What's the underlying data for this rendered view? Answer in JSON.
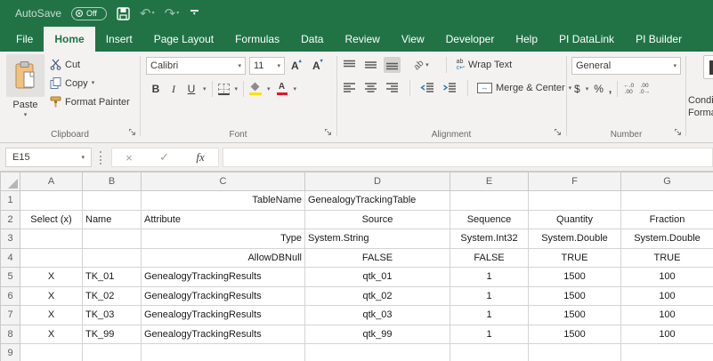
{
  "colors": {
    "title_green": "#217346",
    "cell_blue": "#2a2ad0",
    "selection_green": "#217346"
  },
  "titlebar": {
    "autosave_label": "AutoSave",
    "autosave_state": "Off"
  },
  "tabs": [
    {
      "label": "File",
      "active": false
    },
    {
      "label": "Home",
      "active": true
    },
    {
      "label": "Insert",
      "active": false
    },
    {
      "label": "Page Layout",
      "active": false
    },
    {
      "label": "Formulas",
      "active": false
    },
    {
      "label": "Data",
      "active": false
    },
    {
      "label": "Review",
      "active": false
    },
    {
      "label": "View",
      "active": false
    },
    {
      "label": "Developer",
      "active": false
    },
    {
      "label": "Help",
      "active": false
    },
    {
      "label": "PI DataLink",
      "active": false
    },
    {
      "label": "PI Builder",
      "active": false
    }
  ],
  "ribbon": {
    "clipboard": {
      "paste": "Paste",
      "cut": "Cut",
      "copy": "Copy",
      "format_painter": "Format Painter",
      "label": "Clipboard"
    },
    "font": {
      "name": "Calibri",
      "size": "11",
      "bold": "B",
      "italic": "I",
      "underline": "U",
      "grow_glyph": "A",
      "shrink_glyph": "A",
      "color_glyph": "A",
      "label": "Font"
    },
    "alignment": {
      "orientation_glyph": "ab",
      "wrap_glyph1": "ab",
      "wrap_glyph2": "c↩",
      "wrap_text": "Wrap Text",
      "merge_center": "Merge & Center",
      "merge_glyph": "↔",
      "label": "Alignment"
    },
    "number": {
      "format": "General",
      "currency": "$",
      "percent": "%",
      "comma": ",",
      "inc_top": "←.0",
      "inc_bottom": ".00",
      "dec_top": ".00",
      "dec_bottom": ".0→",
      "label": "Number"
    },
    "conditional": {
      "line1": "Conditional",
      "line2": "Formatting"
    }
  },
  "formula_bar": {
    "name_box": "E15",
    "cancel": "×",
    "enter": "✓",
    "fx": "fx",
    "formula": ""
  },
  "icons": {
    "dropdown": "▾",
    "up_caret": "▴",
    "undo": "↶",
    "redo": "↷"
  },
  "sheet": {
    "cols": [
      "A",
      "B",
      "C",
      "D",
      "E",
      "F",
      "G"
    ],
    "selected_col": "E",
    "rows": [
      "1",
      "2",
      "3",
      "4",
      "5",
      "6",
      "7",
      "8",
      "9"
    ],
    "r1": {
      "C": "TableName",
      "D": "GenealogyTrackingTable"
    },
    "r2": {
      "A": "Select (x)",
      "B": "Name",
      "C": "Attribute",
      "D": "Source",
      "E": "Sequence",
      "F": "Quantity",
      "G": "Fraction"
    },
    "r3": {
      "C": "Type",
      "D": "System.String",
      "E": "System.Int32",
      "F": "System.Double",
      "G": "System.Double"
    },
    "r4": {
      "C": "AllowDBNull",
      "D": "FALSE",
      "E": "FALSE",
      "F": "TRUE",
      "G": "TRUE"
    },
    "r5": {
      "A": "X",
      "B": "TK_01",
      "C": "GenealogyTrackingResults",
      "D": "qtk_01",
      "E": "1",
      "F": "1500",
      "G": "100"
    },
    "r6": {
      "A": "X",
      "B": "TK_02",
      "C": "GenealogyTrackingResults",
      "D": "qtk_02",
      "E": "1",
      "F": "1500",
      "G": "100"
    },
    "r7": {
      "A": "X",
      "B": "TK_03",
      "C": "GenealogyTrackingResults",
      "D": "qtk_03",
      "E": "1",
      "F": "1500",
      "G": "100"
    },
    "r8": {
      "A": "X",
      "B": "TK_99",
      "C": "GenealogyTrackingResults",
      "D": "qtk_99",
      "E": "1",
      "F": "1500",
      "G": "100"
    }
  }
}
